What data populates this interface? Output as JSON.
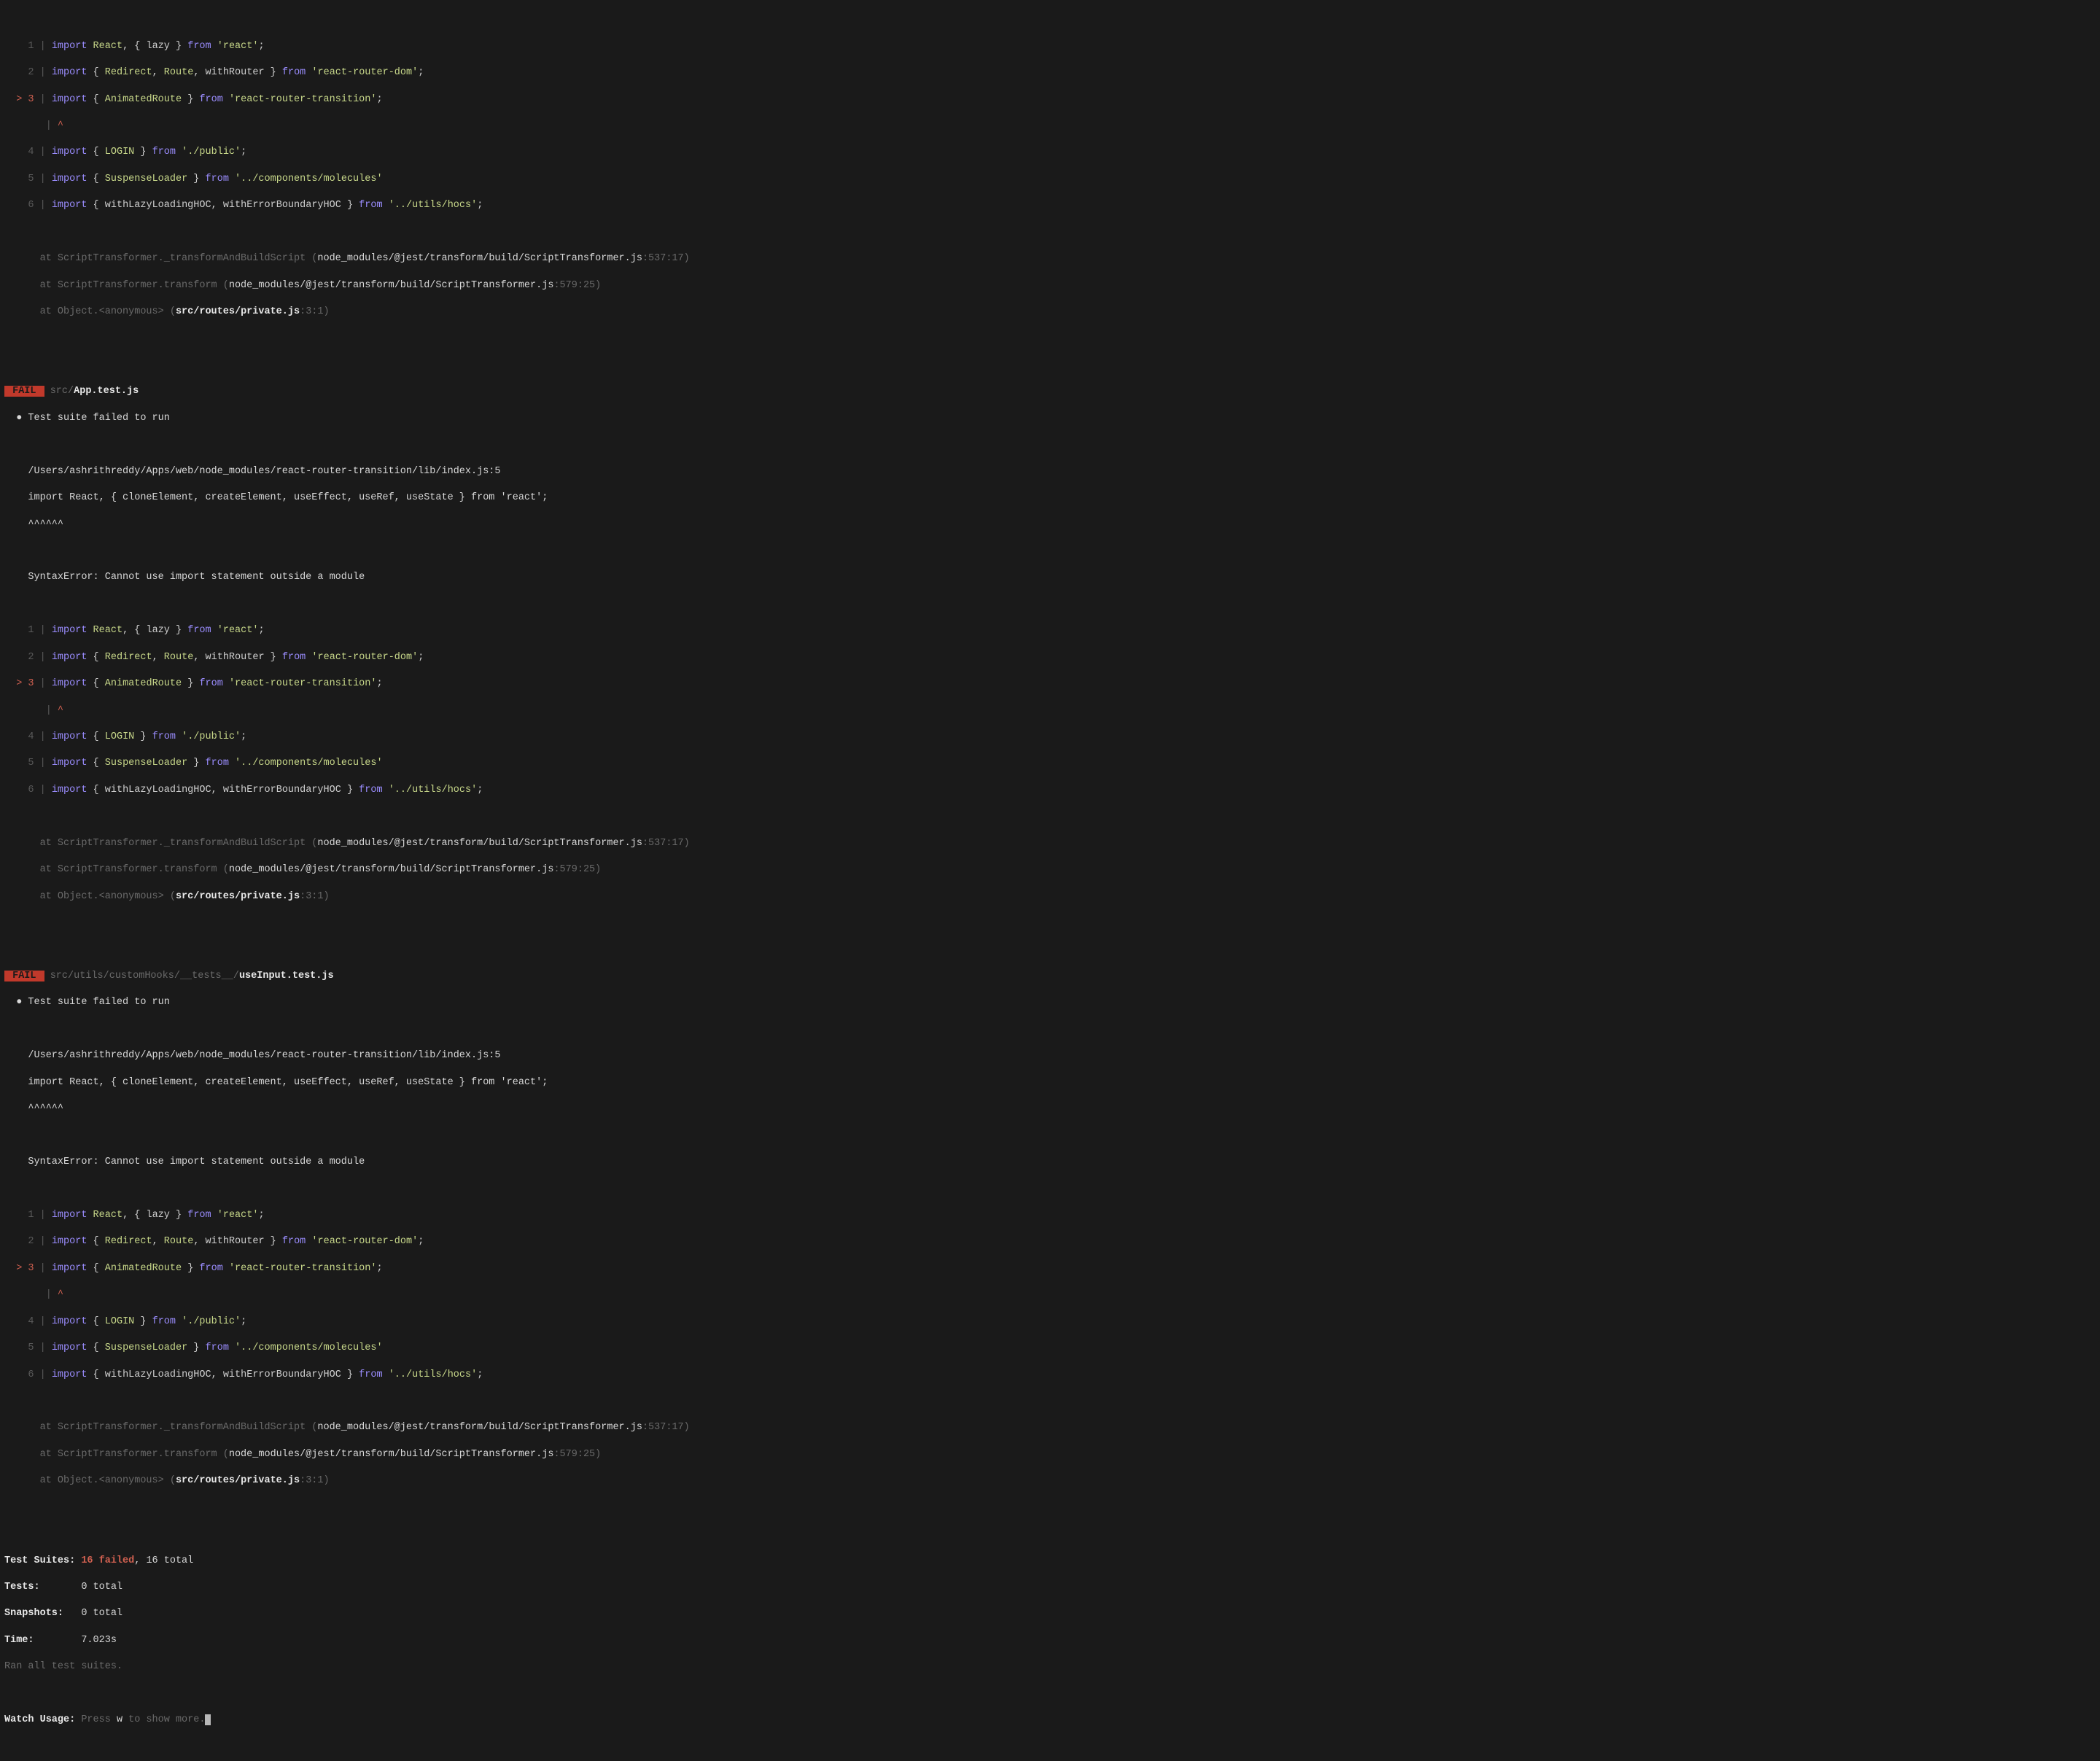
{
  "code": {
    "l1": {
      "n": "1",
      "import": "import",
      "name": "React",
      "comma": ",",
      "lbr": "{",
      "i2": "lazy",
      "rbr": "}",
      "from": "from",
      "str": "'react'",
      "semi": ";"
    },
    "l2": {
      "n": "2",
      "import": "import",
      "lbr": "{",
      "i1": "Redirect",
      "c1": ",",
      "i2": "Route",
      "c2": ",",
      "i3": "withRouter",
      "rbr": "}",
      "from": "from",
      "str": "'react-router-dom'",
      "semi": ";"
    },
    "l3": {
      "n": "> 3",
      "import": "import",
      "lbr": "{",
      "i1": "AnimatedRoute",
      "rbr": "}",
      "from": "from",
      "str": "'react-router-transition'",
      "semi": ";"
    },
    "lcaret": {
      "pad": "       |",
      "caret": " ^"
    },
    "l4": {
      "n": "4",
      "import": "import",
      "lbr": "{",
      "i1": "LOGIN",
      "rbr": "}",
      "from": "from",
      "str": "'./public'",
      "semi": ";"
    },
    "l5": {
      "n": "5",
      "import": "import",
      "lbr": "{",
      "i1": "SuspenseLoader",
      "rbr": "}",
      "from": "from",
      "str": "'../components/molecules'"
    },
    "l6": {
      "n": "6",
      "import": "import",
      "lbr": "{",
      "i1": "withLazyLoadingHOC",
      "c1": ",",
      "i2": "withErrorBoundaryHOC",
      "rbr": "}",
      "from": "from",
      "str": "'../utils/hocs'",
      "semi": ";"
    }
  },
  "stack": {
    "s1a": "      at ScriptTransformer._transformAndBuildScript (",
    "s1b": "node_modules/@jest/transform/build/ScriptTransformer.js",
    "s1c": ":537:17)",
    "s2a": "      at ScriptTransformer.transform (",
    "s2b": "node_modules/@jest/transform/build/ScriptTransformer.js",
    "s2c": ":579:25)",
    "s3a": "      at Object.<anonymous> (",
    "s3b": "src/routes/private.js",
    "s3c": ":3:1)"
  },
  "failBlock": {
    "badge": " FAIL ",
    "pathPre1": " src/",
    "pathBold1": "App.test.js",
    "pathPre2": " src/utils/customHooks/__tests__/",
    "pathBold2": "useInput.test.js",
    "bullet": "  ●",
    "suiteFail": " Test suite failed to run",
    "filePath": "    /Users/ashrithreddy/Apps/web/node_modules/react-router-transition/lib/index.js:5",
    "importLine": "    import React, { cloneElement, createElement, useEffect, useRef, useState } from 'react';",
    "carets": "    ^^^^^^",
    "syntaxErr": "    SyntaxError: Cannot use import statement outside a module"
  },
  "summary": {
    "testSuitesLabel": "Test Suites: ",
    "testSuitesFail": "16 failed",
    "testSuitesRest": ", 16 total",
    "testsLabel": "Tests:       ",
    "testsVal": "0 total",
    "snapsLabel": "Snapshots:   ",
    "snapsVal": "0 total",
    "timeLabel": "Time:        ",
    "timeVal": "7.023s",
    "ran": "Ran all test suites.",
    "watchLabel": "Watch Usage: ",
    "press": "Press ",
    "w": "w",
    "showMore": " to show more."
  }
}
